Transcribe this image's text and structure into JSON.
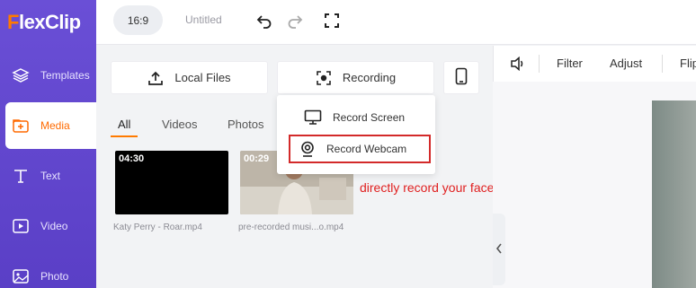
{
  "app": {
    "logo": "FlexClip",
    "logo_first": "F",
    "logo_rest": "lexClip"
  },
  "sidebar": {
    "items": [
      {
        "label": "Templates",
        "icon": "layers-icon"
      },
      {
        "label": "Media",
        "icon": "media-folder-icon",
        "active": true
      },
      {
        "label": "Text",
        "icon": "text-icon"
      },
      {
        "label": "Video",
        "icon": "video-icon"
      },
      {
        "label": "Photo",
        "icon": "photo-icon"
      }
    ]
  },
  "topbar": {
    "ratio": "16:9",
    "title": "Untitled"
  },
  "panel": {
    "local_files": "Local Files",
    "recording": "Recording",
    "tabs": [
      "All",
      "Videos",
      "Photos"
    ],
    "media": [
      {
        "duration": "04:30",
        "label": "Katy Perry - Roar.mp4"
      },
      {
        "duration": "00:29",
        "label": "pre-recorded musi...o.mp4"
      }
    ]
  },
  "dropdown": {
    "record_screen": "Record Screen",
    "record_webcam": "Record Webcam"
  },
  "annotation": "directly record your face reaction on webcam",
  "rightbar": {
    "filter": "Filter",
    "adjust": "Adjust",
    "flip": "Flip"
  },
  "colors": {
    "accent": "#ff7a00",
    "sidebar": "#5f44cc",
    "highlight": "#d32a2a"
  }
}
